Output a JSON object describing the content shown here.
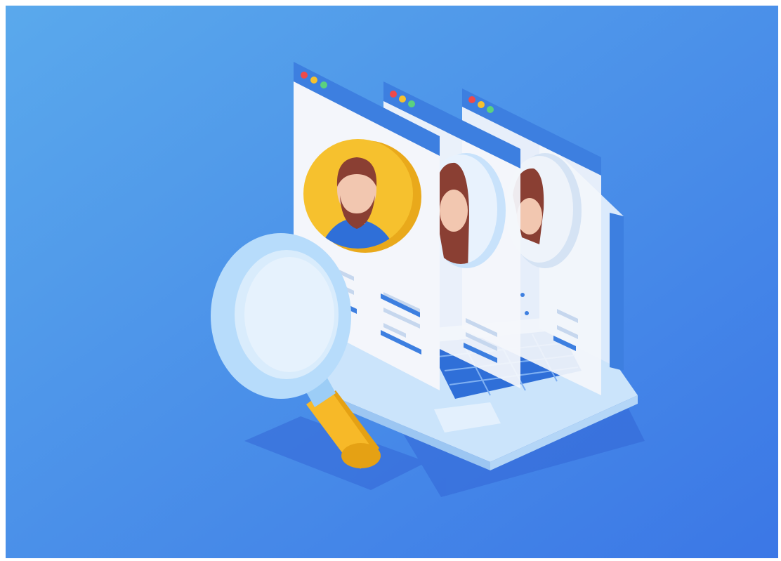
{
  "scene": {
    "subject": "illustration",
    "colors": {
      "background_start": "#5aa9ec",
      "background_end": "#3b77e6",
      "card_face": "#f4f6fb",
      "card_header": "#3d7fe0",
      "avatar_yellow": "#f6c12e",
      "avatar_ring": "#e9a91b",
      "skin": "#f2c7b0",
      "hair": "#8a3f33",
      "shirt": "#2f6fd8",
      "lens_ring": "#b7dcfb",
      "handle": "#f7b928",
      "laptop_body": "#cbe4fb",
      "keyboard": "#2f6fd8",
      "dot_red": "#ef4a4a",
      "dot_yellow": "#f6c12e",
      "dot_green": "#5bd17e"
    },
    "icons": [
      "magnifier-icon",
      "avatar-man-icon",
      "avatar-woman-icon",
      "laptop-icon"
    ]
  }
}
